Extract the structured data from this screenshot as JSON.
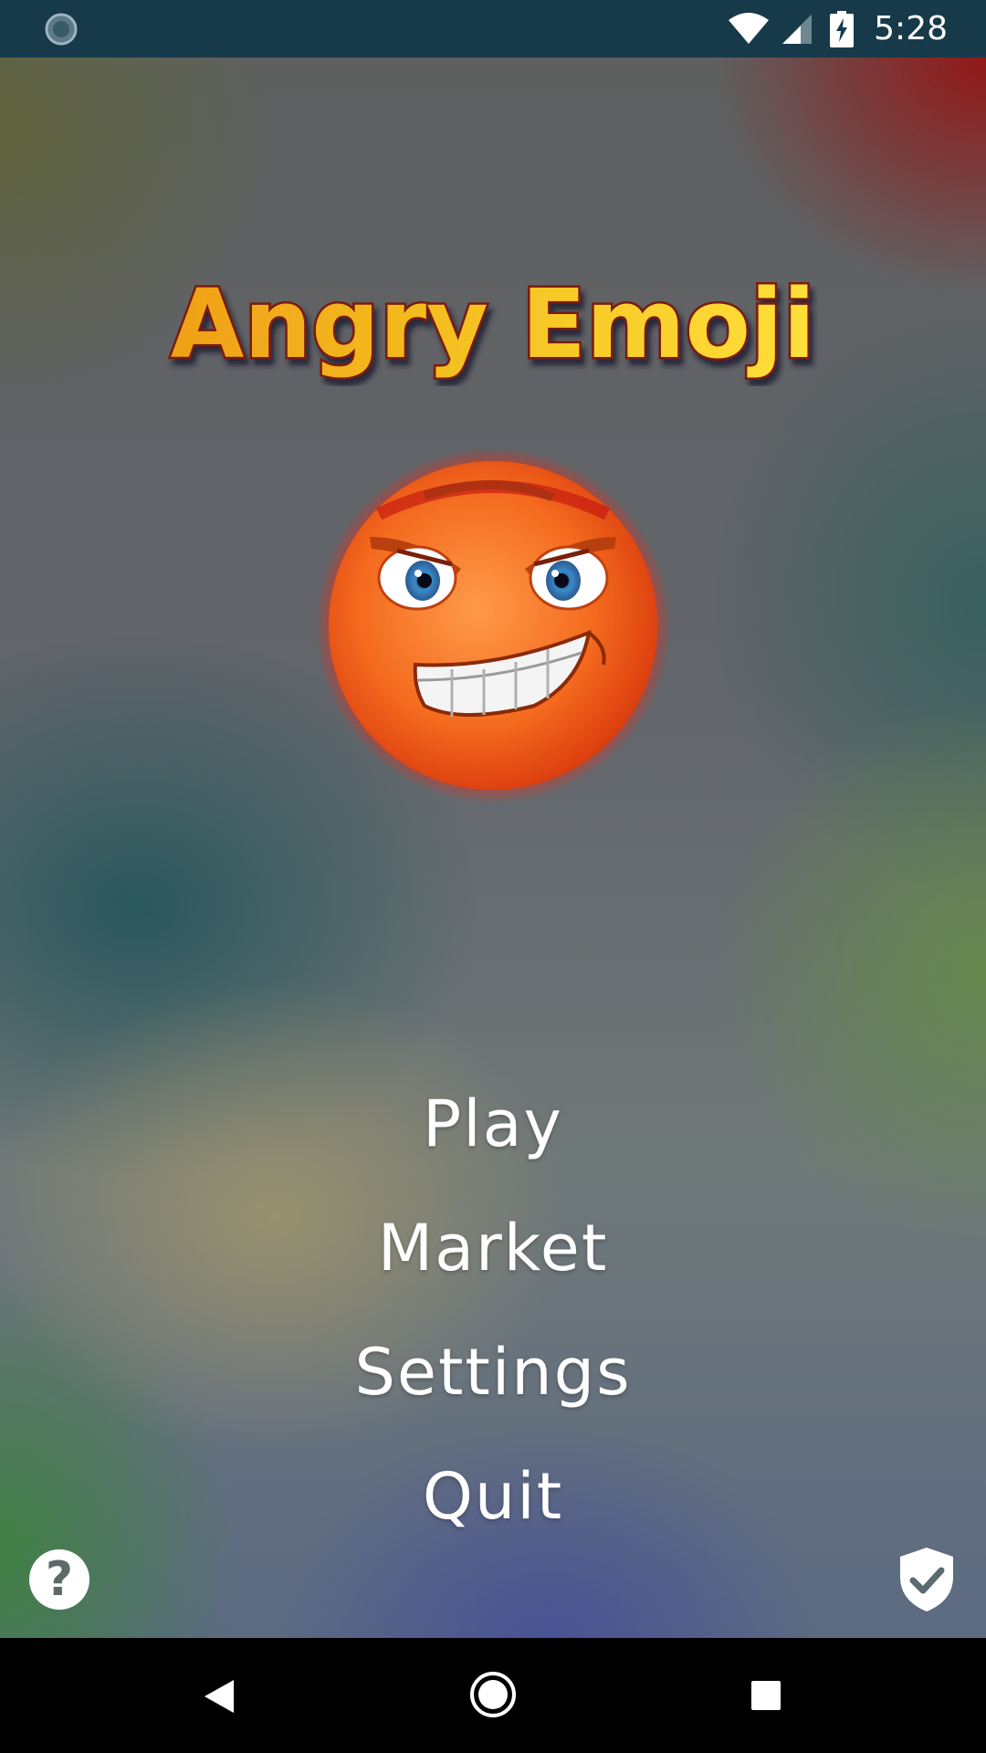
{
  "status_bar": {
    "time": "5:28",
    "left_icon": "loading-spinner-icon",
    "wifi_icon": "wifi-icon",
    "signal_icon": "cell-signal-icon",
    "battery_icon": "battery-charging-icon"
  },
  "game": {
    "title": "Angry Emoji",
    "title_colors": {
      "fill_top": "#ffe23a",
      "fill_bottom": "#e8a010",
      "left_fill": "#f2b020",
      "outline": "#7a1a10"
    },
    "character": "angry-emoji-character",
    "menu": {
      "play": "Play",
      "market": "Market",
      "settings": "Settings",
      "quit": "Quit"
    },
    "help_button_label": "?",
    "help_icon": "question-mark-icon",
    "privacy_icon": "shield-check-icon"
  },
  "nav_bar": {
    "back_icon": "back-triangle-icon",
    "home_icon": "home-circle-icon",
    "recent_icon": "recent-apps-square-icon"
  },
  "colors": {
    "status_bar_bg": "#173a4a",
    "nav_bar_bg": "#000000",
    "menu_text": "#ffffff"
  }
}
